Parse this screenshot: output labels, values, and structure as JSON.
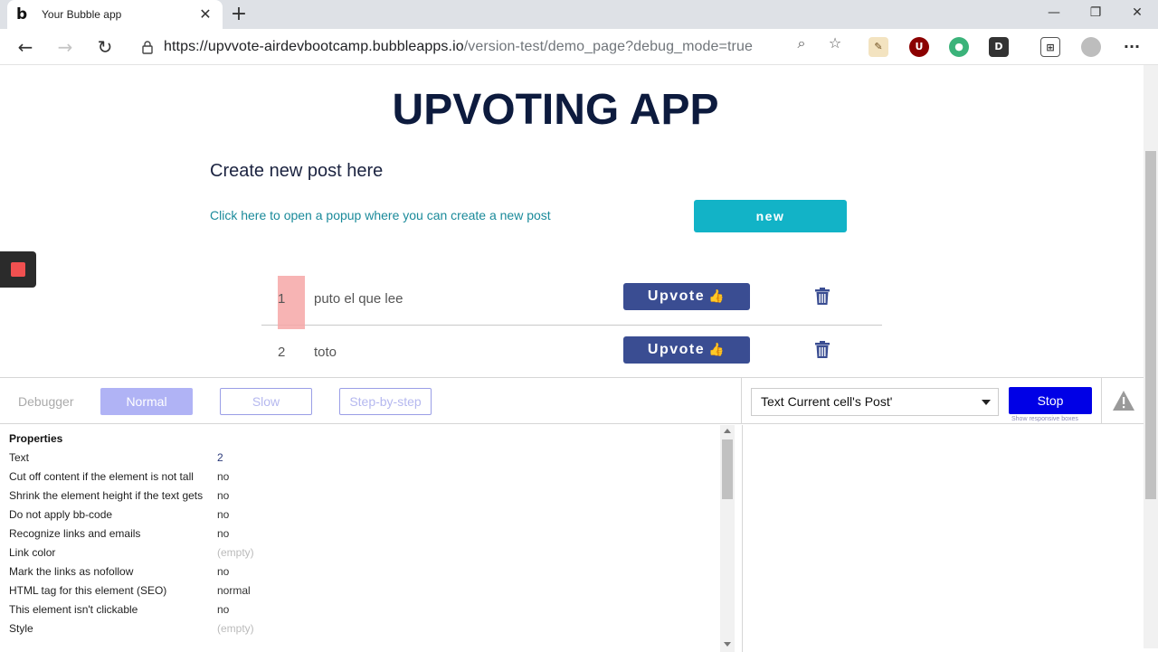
{
  "browser": {
    "tab_title": "Your Bubble app",
    "tab_favicon": "b",
    "url_host": "https://upvvote-airdevbootcamp.bubbleapps.io",
    "url_path": "/version-test/demo_page?debug_mode=true"
  },
  "app": {
    "title": "UPVOTING APP",
    "create_heading": "Create new post here",
    "popup_link": "Click here to open a popup where you can create a new post",
    "new_button": "new",
    "posts": [
      {
        "votes": "1",
        "text": "puto el que lee",
        "upvote_label": "Upvote"
      },
      {
        "votes": "2",
        "text": "toto",
        "upvote_label": "Upvote"
      }
    ]
  },
  "debugger": {
    "label": "Debugger",
    "modes": [
      "Normal",
      "Slow",
      "Step-by-step"
    ],
    "active_mode": "Normal",
    "element_select": "Text Current cell's Post'",
    "stop_label": "Stop",
    "responsive_link": "Show responsive boxes",
    "properties_title": "Properties",
    "properties": [
      {
        "name": "Text",
        "value": "2"
      },
      {
        "name": "Cut off content if the element is not tall",
        "value": "no"
      },
      {
        "name": "Shrink the element height if the text gets",
        "value": "no"
      },
      {
        "name": "Do not apply bb-code",
        "value": "no"
      },
      {
        "name": "Recognize links and emails",
        "value": "no"
      },
      {
        "name": "Link color",
        "value": "(empty)"
      },
      {
        "name": "Mark the links as nofollow",
        "value": "no"
      },
      {
        "name": "HTML tag for this element (SEO)",
        "value": "normal"
      },
      {
        "name": "This element isn't clickable",
        "value": "no"
      },
      {
        "name": "Style",
        "value": "(empty)"
      }
    ]
  },
  "colors": {
    "title": "#0d1b3e",
    "new_button": "#12b3c7",
    "upvote_button": "#3a4d92",
    "stop_button": "#0000e6",
    "highlight": "#f6a7a7"
  }
}
